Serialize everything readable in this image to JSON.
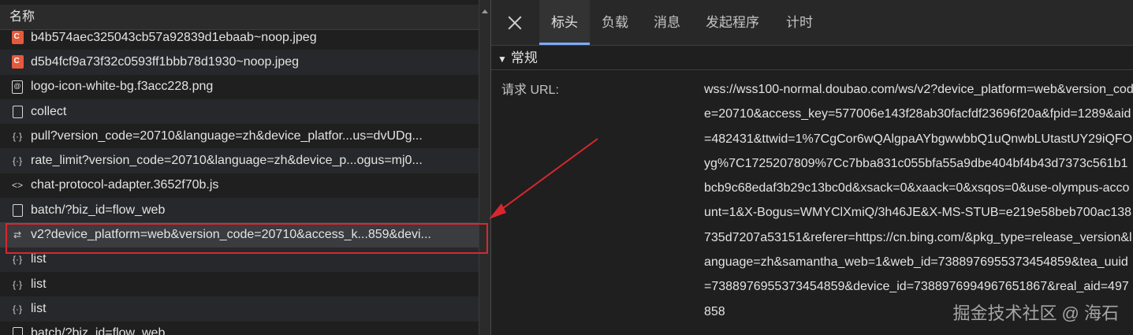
{
  "name_column_header": "名称",
  "requests": [
    {
      "name": "b4b574aec325043cb57a92839d1ebaab~noop.jpeg",
      "icon": "image-icon"
    },
    {
      "name": "d5b4fcf9a73f32c0593ff1bbb78d1930~noop.jpeg",
      "icon": "image-icon"
    },
    {
      "name": "logo-icon-white-bg.f3acc228.png",
      "icon": "png-icon"
    },
    {
      "name": "collect",
      "icon": "document-icon"
    },
    {
      "name": "pull?version_code=20710&language=zh&device_platfor...us=dvUDg...",
      "icon": "fetch-icon"
    },
    {
      "name": "rate_limit?version_code=20710&language=zh&device_p...ogus=mj0...",
      "icon": "fetch-icon"
    },
    {
      "name": "chat-protocol-adapter.3652f70b.js",
      "icon": "script-icon"
    },
    {
      "name": "batch/?biz_id=flow_web",
      "icon": "document-icon"
    },
    {
      "name": "v2?device_platform=web&version_code=20710&access_k...859&devi...",
      "icon": "websocket-icon"
    },
    {
      "name": "list",
      "icon": "fetch-icon"
    },
    {
      "name": "list",
      "icon": "fetch-icon"
    },
    {
      "name": "list",
      "icon": "fetch-icon"
    },
    {
      "name": "batch/?biz_id=flow_web",
      "icon": "document-icon"
    }
  ],
  "tabs": [
    "标头",
    "负载",
    "消息",
    "发起程序",
    "计时"
  ],
  "active_tab": "标头",
  "section_title": "常规",
  "request_url_label": "请求 URL:",
  "request_url_value": "wss://wss100-normal.doubao.com/ws/v2?device_platform=web&version_code=20710&access_key=577006e143f28ab30facfdf23696f20a&fpid=1289&aid=482431&ttwid=1%7CgCor6wQAlgpaAYbgwwbbQ1uQnwbLUtastUY29iQFOyg%7C1725207809%7Cc7bba831c055bfa55a9dbe404bf4b43d7373c561b1bcb9c68edaf3b29c13bc0d&xsack=0&xaack=0&xsqos=0&use-olympus-account=1&X-Bogus=WMYClXmiQ/3h46JE&X-MS-STUB=e219e58beb700ac138735d7207a53151&referer=https://cn.bing.com/&pkg_type=release_version&language=zh&samantha_web=1&web_id=7388976955373454859&tea_uuid=7388976955373454859&device_id=7388976994967651867&real_aid=497858",
  "watermark": "掘金技术社区 @ 海石",
  "colors": {
    "highlight_box": "#d9272e",
    "active_tab_underline": "#7cacf8"
  }
}
